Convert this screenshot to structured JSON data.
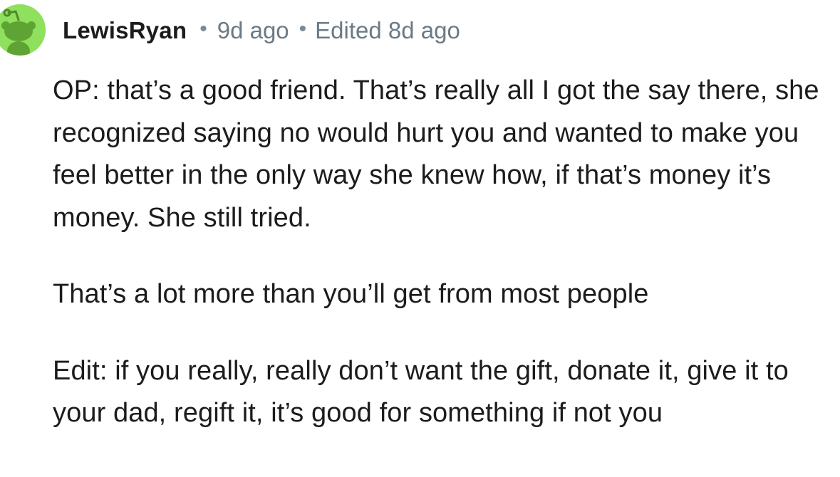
{
  "comment": {
    "username": "LewisRyan",
    "separator": "•",
    "time_ago": "9d ago",
    "edited": "Edited 8d ago",
    "avatar_icon": "reddit-snoo-avatar-icon",
    "avatar_color": "#8fe05c",
    "paragraphs": [
      "OP: that’s a good friend. That’s really all I got the say there, she recognized saying no would hurt you and wanted to make you feel better in the only way she knew how, if that’s money it’s money. She still tried.",
      "That’s a lot more than you’ll get from most people",
      "Edit: if you really, really don’t want the gift, donate it, give it to your dad, regift it, it’s good for something if not you"
    ]
  }
}
